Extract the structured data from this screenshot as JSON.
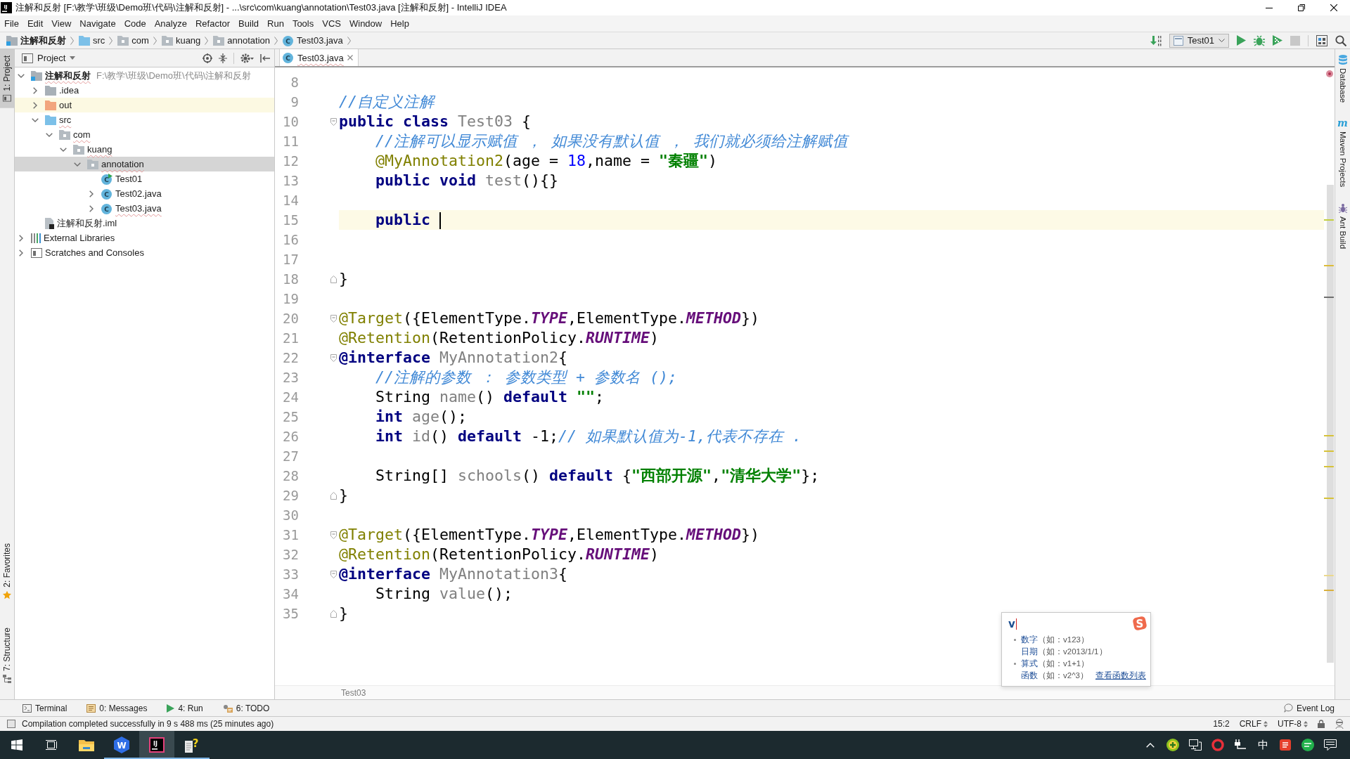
{
  "window": {
    "title": "注解和反射 [F:\\教学\\班级\\Demo班\\代码\\注解和反射] - ...\\src\\com\\kuang\\annotation\\Test03.java [注解和反射] - IntelliJ IDEA",
    "app_icon_text": "IJ"
  },
  "menu": [
    "File",
    "Edit",
    "View",
    "Navigate",
    "Code",
    "Analyze",
    "Refactor",
    "Build",
    "Run",
    "Tools",
    "VCS",
    "Window",
    "Help"
  ],
  "navigation_bar": {
    "breadcrumb": [
      {
        "kind": "module",
        "label": "注解和反射"
      },
      {
        "kind": "source-folder",
        "label": "src"
      },
      {
        "kind": "package",
        "label": "com"
      },
      {
        "kind": "package",
        "label": "kuang"
      },
      {
        "kind": "package",
        "label": "annotation"
      },
      {
        "kind": "class",
        "label": "Test03.java",
        "icon_text": "C"
      }
    ],
    "run_configuration": "Test01"
  },
  "left_stripe": {
    "top": [
      {
        "kind": "project",
        "label": "1: Project",
        "selected": true
      }
    ],
    "bottom": [
      {
        "kind": "favorites",
        "label": "2: Favorites",
        "selected": false
      },
      {
        "kind": "structure",
        "label": "7: Structure",
        "selected": false
      }
    ]
  },
  "right_stripe": [
    {
      "kind": "database",
      "label": "Database",
      "selected": false
    },
    {
      "kind": "maven",
      "label": "Maven Projects",
      "icon_text": "m",
      "selected": false
    },
    {
      "kind": "ant",
      "label": "Ant Build",
      "selected": false
    }
  ],
  "project": {
    "title": "Project",
    "tree": [
      {
        "kind": "module",
        "label": "注解和反射",
        "path": "F:\\教学\\班级\\Demo班\\代码\\注解和反射",
        "expanded": true,
        "selected": false,
        "highlighted": false,
        "problem": true,
        "children": [
          {
            "kind": "folder",
            "label": ".idea",
            "expanded": false,
            "selected": false,
            "highlighted": false,
            "problem": false
          },
          {
            "kind": "excluded-folder",
            "label": "out",
            "expanded": false,
            "selected": false,
            "highlighted": true,
            "problem": false
          },
          {
            "kind": "source-folder",
            "label": "src",
            "expanded": true,
            "selected": false,
            "highlighted": false,
            "problem": true,
            "children": [
              {
                "kind": "package",
                "label": "com",
                "expanded": true,
                "selected": false,
                "highlighted": false,
                "problem": true,
                "children": [
                  {
                    "kind": "package",
                    "label": "kuang",
                    "expanded": true,
                    "selected": false,
                    "highlighted": false,
                    "problem": true,
                    "children": [
                      {
                        "kind": "package",
                        "label": "annotation",
                        "expanded": true,
                        "selected": true,
                        "highlighted": false,
                        "problem": true,
                        "children": [
                          {
                            "kind": "runnable-class",
                            "label": "Test01",
                            "icon_text": "C",
                            "selected": false,
                            "highlighted": false,
                            "problem": false
                          },
                          {
                            "kind": "class",
                            "label": "Test02.java",
                            "icon_text": "C",
                            "expanded": false,
                            "selected": false,
                            "highlighted": false,
                            "problem": false
                          },
                          {
                            "kind": "class",
                            "label": "Test03.java",
                            "icon_text": "C",
                            "expanded": false,
                            "selected": false,
                            "highlighted": false,
                            "problem": true
                          }
                        ]
                      }
                    ]
                  }
                ]
              }
            ]
          },
          {
            "kind": "module-file",
            "label": "注解和反射.iml",
            "selected": false,
            "highlighted": false,
            "problem": false
          }
        ]
      },
      {
        "kind": "libraries",
        "label": "External Libraries",
        "expanded": false,
        "selected": false,
        "highlighted": false,
        "problem": false
      },
      {
        "kind": "scratches",
        "label": "Scratches and Consoles",
        "expanded": false,
        "selected": false,
        "highlighted": false,
        "problem": false
      }
    ]
  },
  "editor": {
    "tabs": [
      {
        "label": "Test03.java",
        "icon_text": "C",
        "selected": true,
        "problem": true
      }
    ],
    "lines": [
      {
        "number": "8",
        "kind": "line",
        "current": false
      },
      {
        "number": "9",
        "kind": "line",
        "current": false,
        "tokens": [
          {
            "kind": "comment",
            "text": "//自定义注解"
          }
        ]
      },
      {
        "number": "10",
        "kind": "fold-start",
        "current": false,
        "tokens": [
          {
            "kind": "keyword",
            "text": "public class "
          },
          {
            "kind": "unused",
            "text": "Test03"
          },
          {
            "kind": "plain",
            "text": " {"
          }
        ]
      },
      {
        "number": "11",
        "kind": "line",
        "current": false,
        "tokens": [
          {
            "kind": "comment",
            "text": "    //注解可以显示赋值 ， 如果没有默认值 ， 我们就必须给注解赋值"
          }
        ]
      },
      {
        "number": "12",
        "kind": "line",
        "current": false,
        "tokens": [
          {
            "kind": "annotation",
            "text": "    @MyAnnotation2"
          },
          {
            "kind": "plain",
            "text": "(age = "
          },
          {
            "kind": "number",
            "text": "18"
          },
          {
            "kind": "plain",
            "text": ",name = "
          },
          {
            "kind": "string",
            "text": "\"秦疆\""
          },
          {
            "kind": "plain",
            "text": ")"
          }
        ]
      },
      {
        "number": "13",
        "kind": "line",
        "current": false,
        "tokens": [
          {
            "kind": "keyword",
            "text": "    public void "
          },
          {
            "kind": "unused",
            "text": "test"
          },
          {
            "kind": "plain",
            "text": "(){}"
          }
        ]
      },
      {
        "number": "14",
        "kind": "line",
        "current": false
      },
      {
        "number": "15",
        "kind": "line",
        "current": true,
        "tokens": [
          {
            "kind": "keyword",
            "text": "    public "
          }
        ]
      },
      {
        "number": "16",
        "kind": "line",
        "current": false
      },
      {
        "number": "17",
        "kind": "line",
        "current": false
      },
      {
        "number": "18",
        "kind": "fold-end",
        "current": false,
        "tokens": [
          {
            "kind": "plain",
            "text": "}"
          }
        ]
      },
      {
        "number": "19",
        "kind": "line",
        "current": false
      },
      {
        "number": "20",
        "kind": "fold-start",
        "current": false,
        "tokens": [
          {
            "kind": "annotation",
            "text": "@Target"
          },
          {
            "kind": "plain",
            "text": "({ElementType."
          },
          {
            "kind": "enum",
            "text": "TYPE"
          },
          {
            "kind": "plain",
            "text": ",ElementType."
          },
          {
            "kind": "enum",
            "text": "METHOD"
          },
          {
            "kind": "plain",
            "text": "})"
          }
        ]
      },
      {
        "number": "21",
        "kind": "line",
        "current": false,
        "tokens": [
          {
            "kind": "annotation",
            "text": "@Retention"
          },
          {
            "kind": "plain",
            "text": "(RetentionPolicy."
          },
          {
            "kind": "enum",
            "text": "RUNTIME"
          },
          {
            "kind": "plain",
            "text": ")"
          }
        ]
      },
      {
        "number": "22",
        "kind": "fold-start",
        "current": false,
        "tokens": [
          {
            "kind": "keyword",
            "text": "@interface "
          },
          {
            "kind": "unused",
            "text": "MyAnnotation2"
          },
          {
            "kind": "plain",
            "text": "{"
          }
        ]
      },
      {
        "number": "23",
        "kind": "line",
        "current": false,
        "tokens": [
          {
            "kind": "comment",
            "text": "    //注解的参数 ： 参数类型 + 参数名 ();"
          }
        ]
      },
      {
        "number": "24",
        "kind": "line",
        "current": false,
        "tokens": [
          {
            "kind": "plain",
            "text": "    String "
          },
          {
            "kind": "unused",
            "text": "name"
          },
          {
            "kind": "plain",
            "text": "() "
          },
          {
            "kind": "keyword",
            "text": "default "
          },
          {
            "kind": "string",
            "text": "\"\""
          },
          {
            "kind": "plain",
            "text": ";"
          }
        ]
      },
      {
        "number": "25",
        "kind": "line",
        "current": false,
        "tokens": [
          {
            "kind": "keyword",
            "text": "    int "
          },
          {
            "kind": "unused",
            "text": "age"
          },
          {
            "kind": "plain",
            "text": "();"
          }
        ]
      },
      {
        "number": "26",
        "kind": "line",
        "current": false,
        "tokens": [
          {
            "kind": "keyword",
            "text": "    int "
          },
          {
            "kind": "unused",
            "text": "id"
          },
          {
            "kind": "plain",
            "text": "() "
          },
          {
            "kind": "keyword",
            "text": "default "
          },
          {
            "kind": "plain",
            "text": "-1;"
          },
          {
            "kind": "comment",
            "text": "// 如果默认值为-1,代表不存在 ."
          }
        ]
      },
      {
        "number": "27",
        "kind": "line",
        "current": false
      },
      {
        "number": "28",
        "kind": "line",
        "current": false,
        "tokens": [
          {
            "kind": "plain",
            "text": "    String[] "
          },
          {
            "kind": "unused",
            "text": "schools"
          },
          {
            "kind": "plain",
            "text": "() "
          },
          {
            "kind": "keyword",
            "text": "default "
          },
          {
            "kind": "plain",
            "text": "{"
          },
          {
            "kind": "string",
            "text": "\"西部开源\""
          },
          {
            "kind": "plain",
            "text": ","
          },
          {
            "kind": "string",
            "text": "\"清华大学\""
          },
          {
            "kind": "plain",
            "text": "};"
          }
        ]
      },
      {
        "number": "29",
        "kind": "fold-end",
        "current": false,
        "tokens": [
          {
            "kind": "plain",
            "text": "}"
          }
        ]
      },
      {
        "number": "30",
        "kind": "line",
        "current": false
      },
      {
        "number": "31",
        "kind": "fold-start",
        "current": false,
        "tokens": [
          {
            "kind": "annotation",
            "text": "@Target"
          },
          {
            "kind": "plain",
            "text": "({ElementType."
          },
          {
            "kind": "enum",
            "text": "TYPE"
          },
          {
            "kind": "plain",
            "text": ",ElementType."
          },
          {
            "kind": "enum",
            "text": "METHOD"
          },
          {
            "kind": "plain",
            "text": "})"
          }
        ]
      },
      {
        "number": "32",
        "kind": "line",
        "current": false,
        "tokens": [
          {
            "kind": "annotation",
            "text": "@Retention"
          },
          {
            "kind": "plain",
            "text": "(RetentionPolicy."
          },
          {
            "kind": "enum",
            "text": "RUNTIME"
          },
          {
            "kind": "plain",
            "text": ")"
          }
        ]
      },
      {
        "number": "33",
        "kind": "fold-start",
        "current": false,
        "tokens": [
          {
            "kind": "keyword",
            "text": "@interface "
          },
          {
            "kind": "unused",
            "text": "MyAnnotation3"
          },
          {
            "kind": "plain",
            "text": "{"
          }
        ]
      },
      {
        "number": "34",
        "kind": "line",
        "current": false,
        "tokens": [
          {
            "kind": "plain",
            "text": "    String "
          },
          {
            "kind": "unused",
            "text": "value"
          },
          {
            "kind": "plain",
            "text": "();"
          }
        ]
      },
      {
        "number": "35",
        "kind": "fold-end",
        "current": false,
        "tokens": [
          {
            "kind": "plain",
            "text": "}"
          }
        ]
      }
    ],
    "breadcrumb": "Test03"
  },
  "tool_windows": [
    {
      "kind": "terminal",
      "label": "Terminal",
      "selected": false
    },
    {
      "kind": "messages",
      "label": "0: Messages",
      "selected": false
    },
    {
      "kind": "run",
      "label": "4: Run",
      "selected": false
    },
    {
      "kind": "todo",
      "label": "6: TODO",
      "selected": false
    }
  ],
  "event_log": "Event Log",
  "status_bar": {
    "message": "Compilation completed successfully in 9 s 488 ms (25 minutes ago)",
    "position": "15:2",
    "line_separator": "CRLF",
    "encoding": "UTF-8"
  },
  "input_method": {
    "typed": "v",
    "logo_text": "S",
    "options": [
      {
        "label": "数字",
        "example": "（如：v123）",
        "dotted": true
      },
      {
        "label": "日期",
        "example": "（如：v2013/1/1）",
        "dotted": false
      },
      {
        "label": "算式",
        "example": "（如：v1+1）",
        "dotted": true
      },
      {
        "label": "函数",
        "example": "（如：v2^3）",
        "dotted": false
      }
    ],
    "link": "查看函数列表"
  },
  "taskbar": {
    "buttons": [
      {
        "kind": "start"
      },
      {
        "kind": "taskview"
      }
    ],
    "apps": [
      {
        "kind": "explorer",
        "running": false,
        "selected": false
      },
      {
        "kind": "office",
        "icon_text": "W",
        "running": true,
        "selected": false
      },
      {
        "kind": "ide",
        "icon_text": "IJ",
        "running": true,
        "selected": true
      },
      {
        "kind": "helpdoc",
        "icon_text": "?",
        "running": true,
        "selected": false
      }
    ],
    "tray": [
      {
        "kind": "chevron"
      },
      {
        "kind": "shield"
      },
      {
        "kind": "monitor"
      },
      {
        "kind": "ring"
      },
      {
        "kind": "plug"
      },
      {
        "kind": "ime",
        "label": "中"
      },
      {
        "kind": "app"
      },
      {
        "kind": "chat"
      },
      {
        "kind": "notifications"
      }
    ]
  }
}
